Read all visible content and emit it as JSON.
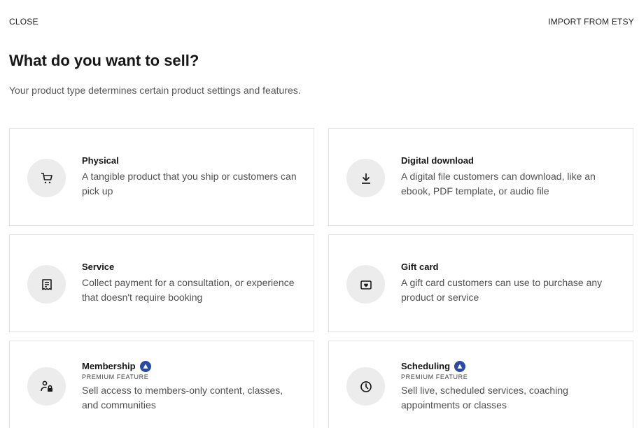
{
  "topbar": {
    "close_label": "CLOSE",
    "import_label": "IMPORT FROM ETSY"
  },
  "header": {
    "title": "What do you want to sell?",
    "subtitle": "Your product type determines certain product settings and features."
  },
  "cards": [
    {
      "title": "Physical",
      "description": "A tangible product that you ship or customers can pick up",
      "icon": "cart-icon"
    },
    {
      "title": "Digital download",
      "description": "A digital file customers can download, like an ebook, PDF template, or audio file",
      "icon": "download-icon"
    },
    {
      "title": "Service",
      "description": "Collect payment for a consultation, or experience that doesn't require booking",
      "icon": "receipt-icon"
    },
    {
      "title": "Gift card",
      "description": "A gift card customers can use to purchase any product or service",
      "icon": "gift-card-icon"
    },
    {
      "title": "Membership",
      "premium_label": "PREMIUM FEATURE",
      "description": "Sell access to members-only content, classes, and communities",
      "icon": "member-lock-icon"
    },
    {
      "title": "Scheduling",
      "premium_label": "PREMIUM FEATURE",
      "description": "Sell live, scheduled services, coaching appointments or classes",
      "icon": "clock-icon"
    }
  ],
  "colors": {
    "premium_badge": "#2b4aa8",
    "icon_circle": "#ececec",
    "card_border": "#e2e2e2"
  }
}
